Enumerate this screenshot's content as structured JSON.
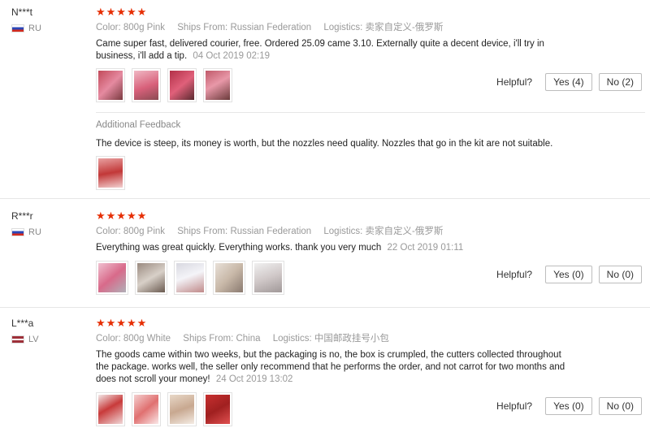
{
  "labels": {
    "stars": "★★★★★",
    "helpful": "Helpful?",
    "color_label": "Color:",
    "ships_label": "Ships From:",
    "logistics_label": "Logistics:",
    "additional_feedback": "Additional Feedback"
  },
  "reviews": [
    {
      "user": "N***t",
      "country": "RU",
      "color": "800g Pink",
      "ships_from": "Russian Federation",
      "logistics": "卖家自定义-俄罗斯",
      "text": "Came super fast, delivered courier, free. Ordered 25.09 came 3.10. Externally quite a decent device, i'll try in business, i'll add a tip.",
      "date": "04 Oct 2019 02:19",
      "yes": "Yes (4)",
      "no": "No (2)",
      "additional": {
        "text": "The device is steep, its money is worth, but the nozzles need quality. Nozzles that go in the kit are not suitable."
      }
    },
    {
      "user": "R***r",
      "country": "RU",
      "color": "800g Pink",
      "ships_from": "Russian Federation",
      "logistics": "卖家自定义-俄罗斯",
      "text": "Everything was great quickly. Everything works. thank you very much",
      "date": "22 Oct 2019 01:11",
      "yes": "Yes (0)",
      "no": "No (0)"
    },
    {
      "user": "L***a",
      "country": "LV",
      "color": "800g White",
      "ships_from": "China",
      "logistics": "中国邮政挂号小包",
      "text": "The goods came within two weeks, but the packaging is no, the box is crumpled, the cutters collected throughout the package. works well, the seller only recommend that he performs the order, and not carrot for two months and does not scroll your money!",
      "date": "24 Oct 2019 13:02",
      "yes": "Yes (0)",
      "no": "No (0)"
    }
  ]
}
